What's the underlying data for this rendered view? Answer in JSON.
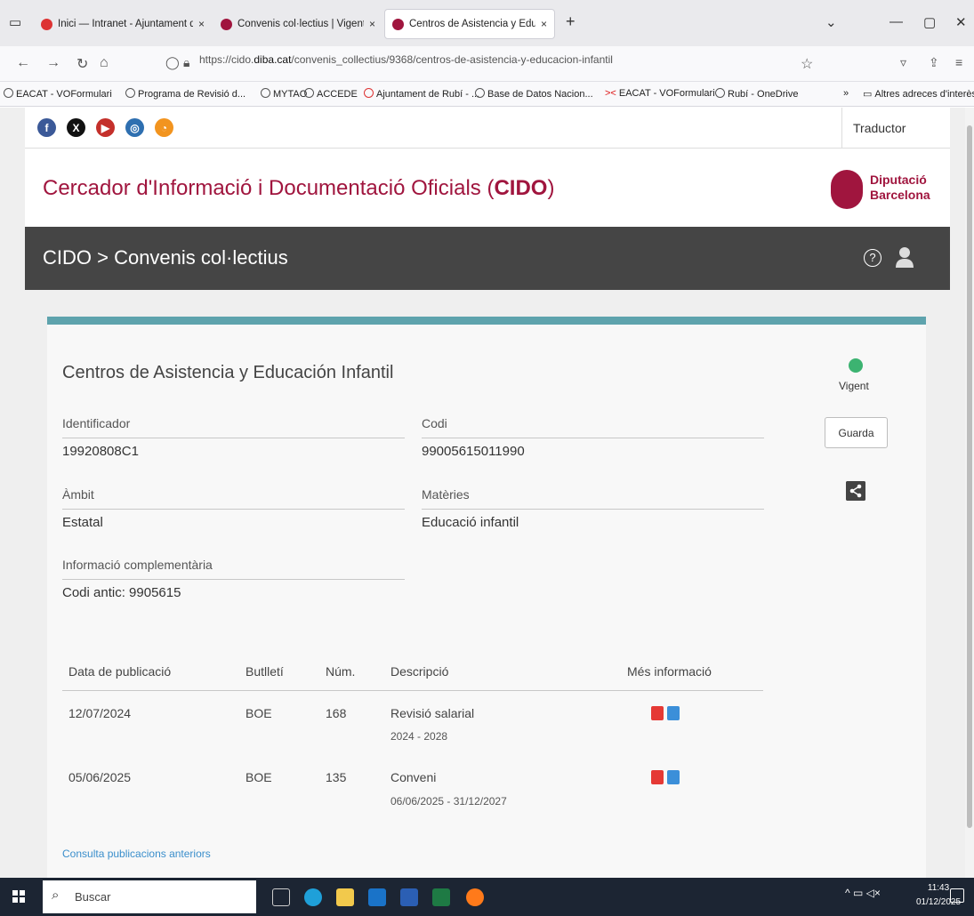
{
  "browser": {
    "tabs": [
      {
        "title": "Inici — Intranet - Ajuntament d",
        "close": "×"
      },
      {
        "title": "Convenis col·lectius | Vigent | E",
        "close": "×"
      },
      {
        "title": "Centros de Asistencia y Educaci",
        "close": "×"
      }
    ],
    "new_tab": "+",
    "url_prefix": "https://cido.",
    "url_domain": "diba.cat",
    "url_path": "/convenis_collectius/9368/centros-de-asistencia-y-educacion-infantil",
    "bookmarks": [
      "EACAT - VOFormulari",
      "Programa de Revisió d...",
      "MYTAO",
      "ACCEDE",
      "Ajuntament de Rubí - ...",
      "Base de Datos Nacion...",
      "EACAT - VOFormulari",
      "Rubí - OneDrive"
    ],
    "bookmarks_more": "Altres adreces d'interès"
  },
  "header": {
    "translator": "Traductor",
    "title_prefix": "Cercador d'Informació i Documentació Oficials (",
    "title_bold": "CIDO",
    "title_suffix": ")",
    "logo_line1": "Diputació",
    "logo_line2": "Barcelona",
    "breadcrumb": "CIDO > Convenis col·lectius",
    "help_symbol": "?"
  },
  "card": {
    "title": "Centros de Asistencia y Educación Infantil",
    "status": "Vigent",
    "save_label": "Guarda",
    "fields": {
      "identificador_label": "Identificador",
      "identificador_value": "19920808C1",
      "codi_label": "Codi",
      "codi_value": "99005615011990",
      "ambit_label": "Àmbit",
      "ambit_value": "Estatal",
      "materies_label": "Matèries",
      "materies_value": "Educació infantil",
      "info_label": "Informació complementària",
      "info_value": "Codi antic: 9905615"
    },
    "table": {
      "headers": [
        "Data de publicació",
        "Butlletí",
        "Núm.",
        "Descripció",
        "Més informació"
      ],
      "rows": [
        {
          "date": "12/07/2024",
          "bulletin": "BOE",
          "num": "168",
          "desc": "Revisió salarial",
          "sub": "2024 - 2028"
        },
        {
          "date": "05/06/2025",
          "bulletin": "BOE",
          "num": "135",
          "desc": "Conveni",
          "sub": "06/06/2025 - 31/12/2027"
        }
      ]
    },
    "more_link": "Consulta publicacions anteriors"
  },
  "taskbar": {
    "search": "Buscar",
    "time": "11:43",
    "date": "01/12/2025"
  },
  "colors": {
    "brand": "#a0153e",
    "accent": "#5ea3ad",
    "status_green": "#3cb371",
    "link": "#3a8ecb"
  },
  "icons": [
    "facebook-icon",
    "x-icon",
    "youtube-icon",
    "instagram-icon",
    "rss-icon",
    "help-icon",
    "user-icon",
    "share-icon",
    "pdf-icon",
    "external-link-icon"
  ]
}
